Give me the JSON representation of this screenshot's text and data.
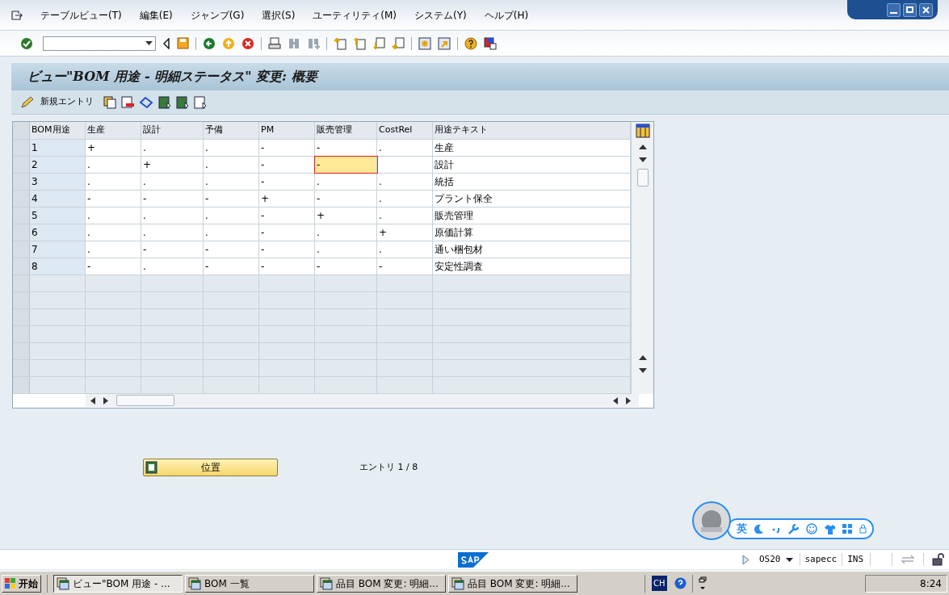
{
  "menu_bar": [
    "テーブルビュー(T)",
    "編集(E)",
    "ジャンプ(G)",
    "選択(S)",
    "ユーティリティ(M)",
    "システム(Y)",
    "ヘルプ(H)"
  ],
  "title": "ビュー\"BOM 用途 - 明細ステータス\" 変更: 概要",
  "app_toolbar": {
    "new_entries": "新規エントリ"
  },
  "table": {
    "columns": [
      "BOM用途",
      "生産",
      "設計",
      "予備",
      "PM",
      "販売管理",
      "CostRel",
      "用途テキスト"
    ],
    "rows": [
      {
        "cells": [
          {
            "text": "1",
            "focused": false
          },
          {
            "text": "+",
            "focused": false
          },
          {
            "text": ".",
            "focused": false
          },
          {
            "text": ".",
            "focused": false
          },
          {
            "text": "-",
            "focused": false
          },
          {
            "text": "-",
            "focused": false
          },
          {
            "text": ".",
            "focused": false
          },
          {
            "text": "生産",
            "focused": false
          }
        ]
      },
      {
        "cells": [
          {
            "text": "2",
            "focused": false
          },
          {
            "text": ".",
            "focused": false
          },
          {
            "text": "+",
            "focused": false
          },
          {
            "text": ".",
            "focused": false
          },
          {
            "text": "-",
            "focused": false
          },
          {
            "text": "-",
            "focused": true
          },
          {
            "text": "",
            "focused": false
          },
          {
            "text": "設計",
            "focused": false
          }
        ]
      },
      {
        "cells": [
          {
            "text": "3",
            "focused": false
          },
          {
            "text": ".",
            "focused": false
          },
          {
            "text": ".",
            "focused": false
          },
          {
            "text": ".",
            "focused": false
          },
          {
            "text": "-",
            "focused": false
          },
          {
            "text": ".",
            "focused": false
          },
          {
            "text": ".",
            "focused": false
          },
          {
            "text": "統括",
            "focused": false
          }
        ]
      },
      {
        "cells": [
          {
            "text": "4",
            "focused": false
          },
          {
            "text": "-",
            "focused": false
          },
          {
            "text": "-",
            "focused": false
          },
          {
            "text": "-",
            "focused": false
          },
          {
            "text": "+",
            "focused": false
          },
          {
            "text": "-",
            "focused": false
          },
          {
            "text": ".",
            "focused": false
          },
          {
            "text": "プラント保全",
            "focused": false
          }
        ]
      },
      {
        "cells": [
          {
            "text": "5",
            "focused": false
          },
          {
            "text": ".",
            "focused": false
          },
          {
            "text": ".",
            "focused": false
          },
          {
            "text": ".",
            "focused": false
          },
          {
            "text": "-",
            "focused": false
          },
          {
            "text": "+",
            "focused": false
          },
          {
            "text": ".",
            "focused": false
          },
          {
            "text": "販売管理",
            "focused": false
          }
        ]
      },
      {
        "cells": [
          {
            "text": "6",
            "focused": false
          },
          {
            "text": ".",
            "focused": false
          },
          {
            "text": ".",
            "focused": false
          },
          {
            "text": ".",
            "focused": false
          },
          {
            "text": "-",
            "focused": false
          },
          {
            "text": ".",
            "focused": false
          },
          {
            "text": "+",
            "focused": false
          },
          {
            "text": "原価計算",
            "focused": false
          }
        ]
      },
      {
        "cells": [
          {
            "text": "7",
            "focused": false
          },
          {
            "text": ".",
            "focused": false
          },
          {
            "text": "-",
            "focused": false
          },
          {
            "text": "-",
            "focused": false
          },
          {
            "text": "-",
            "focused": false
          },
          {
            "text": ".",
            "focused": false
          },
          {
            "text": ".",
            "focused": false
          },
          {
            "text": "通い梱包材",
            "focused": false
          }
        ]
      },
      {
        "cells": [
          {
            "text": "8",
            "focused": false
          },
          {
            "text": "-",
            "focused": false
          },
          {
            "text": ".",
            "focused": false
          },
          {
            "text": "-",
            "focused": false
          },
          {
            "text": "-",
            "focused": false
          },
          {
            "text": "-",
            "focused": false
          },
          {
            "text": "-",
            "focused": false
          },
          {
            "text": "安定性調査",
            "focused": false
          }
        ]
      }
    ]
  },
  "position_button": "位置",
  "entry_count": "エントリ 1 / 8",
  "ime_bar": {
    "mode": "英"
  },
  "status_bar": {
    "system": "OS20",
    "server": "sapecc",
    "mode": "INS"
  },
  "taskbar": {
    "start": "开始",
    "tasks": [
      {
        "label": "ビュー\"BOM 用途 - ...",
        "selected": true
      },
      {
        "label": "BOM 一覧",
        "selected": false
      },
      {
        "label": "品目 BOM 変更: 明細...",
        "selected": false
      },
      {
        "label": "品目 BOM 変更: 明細...",
        "selected": false
      }
    ],
    "language": "CH",
    "clock": "8:24"
  }
}
